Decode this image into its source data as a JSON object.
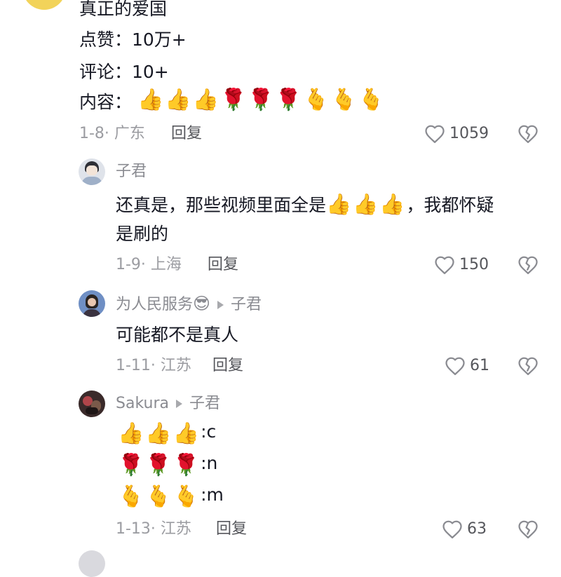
{
  "top_comment": {
    "line1": "真正的爱国",
    "line2": "点赞：10万+",
    "line3": "评论：10+",
    "line4_label": "内容：",
    "line4_emojis": "👍👍👍🌹🌹🌹🫰🫰🫰",
    "date_loc": "1-8· 广东",
    "reply_label": "回复",
    "likes": "1059"
  },
  "replies": [
    {
      "name": "子君",
      "text_a": "还真是，那些视频里面全是",
      "text_emojis": "👍👍👍",
      "text_b": "，我都怀疑",
      "text_c": "是刷的",
      "date_loc": "1-9· 上海",
      "reply_label": "回复",
      "likes": "150"
    },
    {
      "name": "为人民服务",
      "name_emoji": "😎",
      "target": "子君",
      "text": "可能都不是真人",
      "date_loc": "1-11· 江苏",
      "reply_label": "回复",
      "likes": "61"
    },
    {
      "name": "Sakura",
      "target": "子君",
      "row1_emojis": "👍👍👍",
      "row1_text": ":c",
      "row2_emojis": "🌹🌹🌹",
      "row2_text": ":n",
      "row3_emojis": "🫰🫰🫰",
      "row3_text": ":m",
      "date_loc": "1-13· 江苏",
      "reply_label": "回复",
      "likes": "63"
    }
  ]
}
